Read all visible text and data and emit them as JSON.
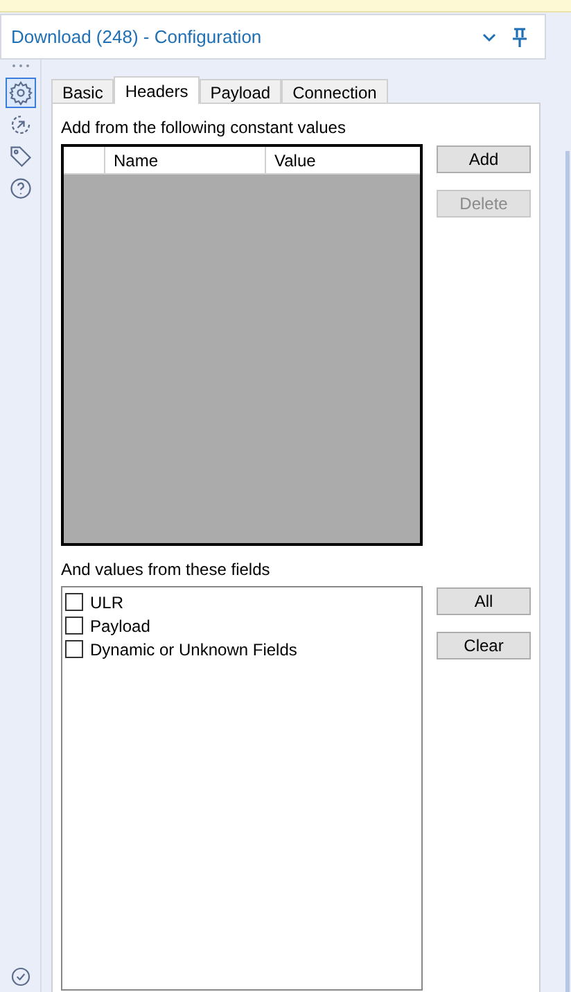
{
  "header": {
    "title": "Download (248) - Configuration"
  },
  "rail": [
    {
      "kind": "gear",
      "selected": true
    },
    {
      "kind": "arrow",
      "selected": false
    },
    {
      "kind": "tag",
      "selected": false
    },
    {
      "kind": "help",
      "selected": false
    }
  ],
  "tabs": [
    {
      "label": "Basic",
      "selected": false
    },
    {
      "label": "Headers",
      "selected": true
    },
    {
      "label": "Payload",
      "selected": false
    },
    {
      "label": "Connection",
      "selected": false
    }
  ],
  "constants": {
    "label": "Add from the following constant values",
    "columns": [
      "Name",
      "Value"
    ],
    "buttons": [
      {
        "label": "Add",
        "disabled": false
      },
      {
        "label": "Delete",
        "disabled": true
      }
    ]
  },
  "fields": {
    "label": "And values from these fields",
    "items": [
      {
        "label": "ULR",
        "checked": false
      },
      {
        "label": "Payload",
        "checked": false
      },
      {
        "label": "Dynamic or Unknown Fields",
        "checked": false
      }
    ],
    "buttons": [
      {
        "label": "All",
        "disabled": false
      },
      {
        "label": "Clear",
        "disabled": false
      }
    ]
  }
}
